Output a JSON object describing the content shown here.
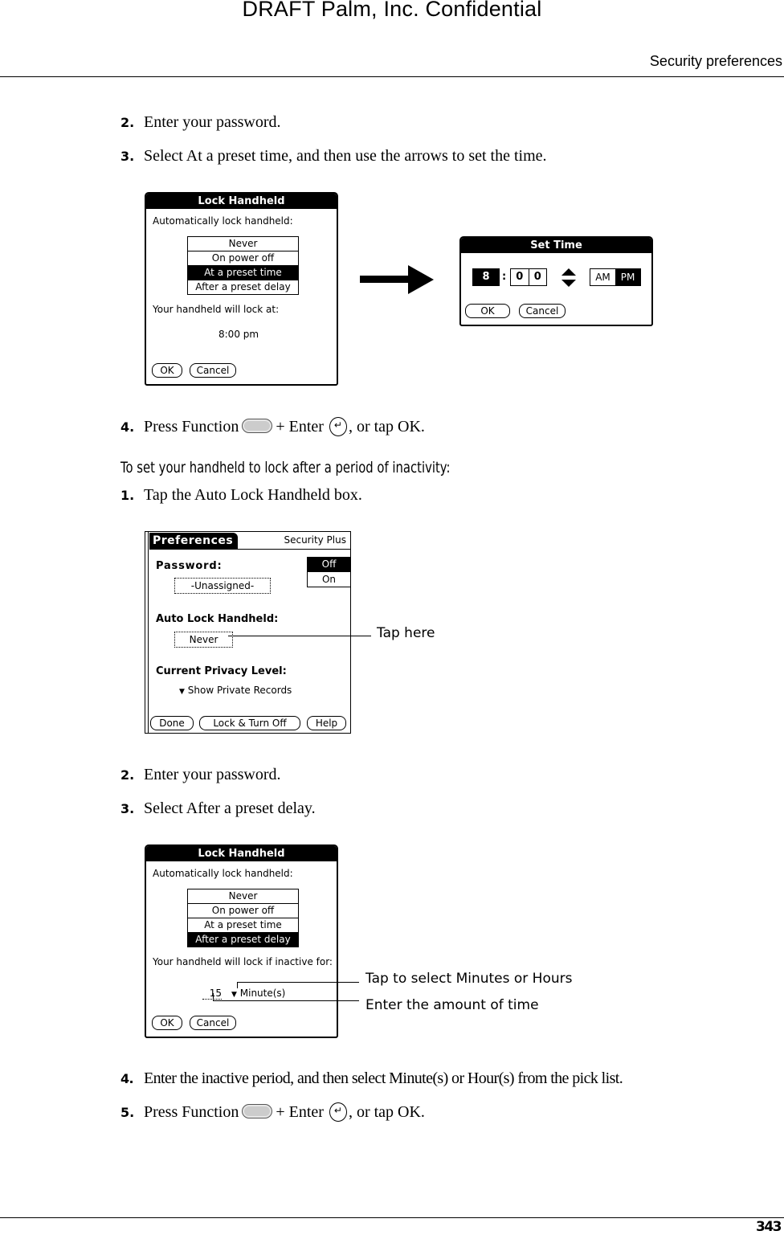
{
  "watermark": "DRAFT   Palm, Inc. Confidential",
  "header": {
    "section_title": "Security preferences"
  },
  "steps_a": [
    {
      "num": "2.",
      "text": "Enter your password."
    },
    {
      "num": "3.",
      "text": "Select At a preset time, and then use the arrows to set the time."
    }
  ],
  "lock_dialog_1": {
    "title": "Lock Handheld",
    "prompt": "Automatically lock handheld:",
    "options": [
      "Never",
      "On power off",
      "At a preset time",
      "After a preset delay"
    ],
    "selected": "At a preset time",
    "lock_label": "Your handheld will lock at:",
    "lock_time": "8:00 pm",
    "ok": "OK",
    "cancel": "Cancel"
  },
  "set_time_dialog": {
    "title": "Set Time",
    "hour": "8",
    "separator": ":",
    "minute_tens": "0",
    "minute_ones": "0",
    "am": "AM",
    "pm": "PM",
    "selected_meridiem": "PM",
    "ok": "OK",
    "cancel": "Cancel"
  },
  "step_a4": {
    "num": "4.",
    "pre": "Press Function",
    "mid": "+ Enter",
    "post": ", or tap OK.",
    "enter_glyph": "↵"
  },
  "procedure_heading": "To set your handheld to lock after a period of inactivity:",
  "step_b1": {
    "num": "1.",
    "text": "Tap the Auto Lock Handheld box."
  },
  "prefs_screen": {
    "tab": "Preferences",
    "panel": "Security Plus",
    "password_label": "Password:",
    "password_value": "-Unassigned-",
    "toggle_off": "Off",
    "toggle_on": "On",
    "toggle_selected": "Off",
    "autolock_label": "Auto Lock Handheld:",
    "autolock_value": "Never",
    "privacy_label": "Current Privacy Level:",
    "privacy_value": "Show Private Records",
    "done": "Done",
    "lock_turn_off": "Lock & Turn Off",
    "help": "Help"
  },
  "callout_tap_here": "Tap here",
  "steps_b": [
    {
      "num": "2.",
      "text": "Enter your password."
    },
    {
      "num": "3.",
      "text": "Select After a preset delay."
    }
  ],
  "lock_dialog_2": {
    "title": "Lock Handheld",
    "prompt": "Automatically lock handheld:",
    "options": [
      "Never",
      "On power off",
      "At a preset time",
      "After a preset delay"
    ],
    "selected": "After a preset delay",
    "lock_label": "Your handheld will lock if inactive for:",
    "amount": "15",
    "unit": "Minute(s)",
    "ok": "OK",
    "cancel": "Cancel"
  },
  "callout_minutes_hours": "Tap to select Minutes or Hours",
  "callout_amount": "Enter the amount of time",
  "step_b4": {
    "num": "4.",
    "text": "Enter the inactive period, and then select Minute(s) or Hour(s) from the pick list."
  },
  "step_b5": {
    "num": "5.",
    "pre": "Press Function",
    "mid": "+ Enter",
    "post": ", or tap OK.",
    "enter_glyph": "↵"
  },
  "footer": {
    "page_number": "343"
  }
}
